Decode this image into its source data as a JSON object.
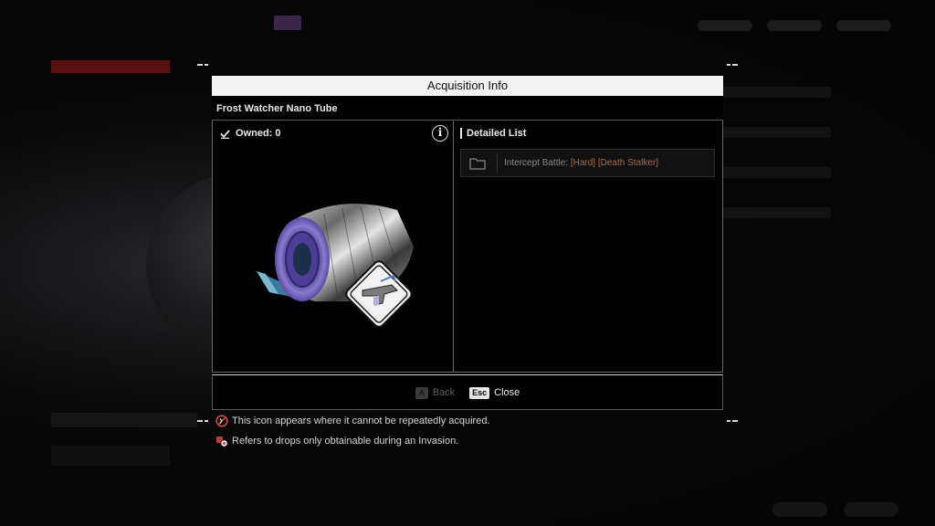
{
  "dialog": {
    "header": "Acquisition Info",
    "item_name": "Frost Watcher Nano Tube",
    "owned_label": "Owned: 0",
    "info_icon_glyph": "i",
    "detailed_list_title": "Detailed List",
    "source": {
      "prefix": "Intercept Battle: ",
      "tag1": "[Hard]",
      "tag2": "[Death Stalker]"
    },
    "footer": {
      "back_key": "A",
      "back_label": "Back",
      "close_key": "Esc",
      "close_label": "Close"
    }
  },
  "notes": [
    {
      "icon": "non-repeatable-icon",
      "text": "This icon appears where it cannot be repeatedly acquired."
    },
    {
      "icon": "invasion-drop-icon",
      "text": "Refers to drops only obtainable during an Invasion."
    }
  ],
  "colors": {
    "header_bg": "#f2f2f2",
    "highlight_tag": "#a86a48",
    "background": "#050505"
  }
}
